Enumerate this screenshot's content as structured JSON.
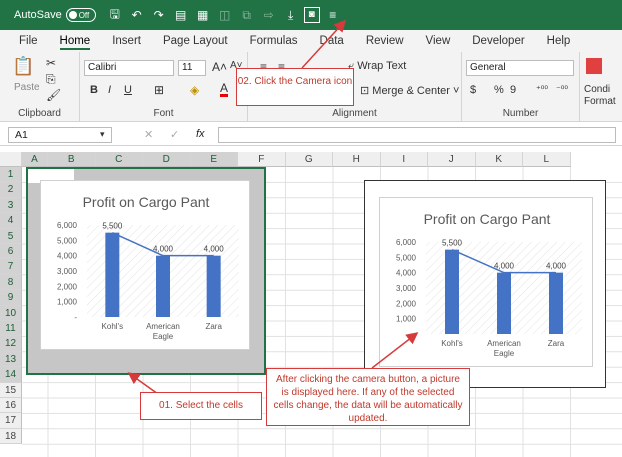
{
  "titlebar": {
    "autosave_label": "AutoSave",
    "autosave_state": "Off",
    "quick_access": [
      "save-icon",
      "undo-icon",
      "redo-icon",
      "format-painter-icon",
      "print-preview-icon",
      "camera-icon"
    ]
  },
  "tabs": [
    "File",
    "Home",
    "Insert",
    "Page Layout",
    "Formulas",
    "Data",
    "Review",
    "View",
    "Developer",
    "Help"
  ],
  "active_tab": "Home",
  "ribbon": {
    "clipboard_label": "Clipboard",
    "paste_label": "Paste",
    "font_label": "Font",
    "font_name": "Calibri",
    "font_size": "11",
    "bold": "B",
    "italic": "I",
    "underline": "U",
    "alignment_label": "Alignment",
    "wrap_text": "Wrap Text",
    "merge_center": "Merge & Center",
    "number_label": "Number",
    "number_format": "General",
    "currency": "$",
    "percent": "%",
    "comma": "9",
    "conditional": "Condi",
    "formatting": "Format"
  },
  "formula_bar": {
    "name_box": "A1",
    "fx": "fx",
    "value": ""
  },
  "columns": [
    "A",
    "B",
    "C",
    "D",
    "E",
    "F",
    "G",
    "H",
    "I",
    "J",
    "K",
    "L"
  ],
  "rows": [
    "1",
    "2",
    "3",
    "4",
    "5",
    "6",
    "7",
    "8",
    "9",
    "10",
    "11",
    "12",
    "13",
    "14",
    "15",
    "16",
    "17",
    "18"
  ],
  "callouts": {
    "camera": "02. Click the Camera icon",
    "select": "01. Select the cells",
    "info": "After clicking the camera button, a picture is displayed here. If any of the selected cells change, the data will be automatically updated."
  },
  "chart_data": [
    {
      "type": "bar",
      "title": "Profit on Cargo Pant",
      "categories": [
        "Kohl's",
        "American Eagle",
        "Zara"
      ],
      "values": [
        5500,
        4000,
        4000
      ],
      "value_labels": [
        "5,500",
        "4,000",
        "4,000"
      ],
      "trendline": true,
      "y_ticks": [
        "-",
        "1,000",
        "2,000",
        "3,000",
        "4,000",
        "5,000",
        "6,000"
      ],
      "ylim": [
        0,
        6000
      ],
      "bar_color": "#4472c4"
    },
    {
      "type": "bar",
      "title": "Profit on Cargo Pant",
      "categories": [
        "Kohl's",
        "American Eagle",
        "Zara"
      ],
      "values": [
        5500,
        4000,
        4000
      ],
      "value_labels": [
        "5,500",
        "4,000",
        "4,000"
      ],
      "trendline": true,
      "y_ticks": [
        "-",
        "1,000",
        "2,000",
        "3,000",
        "4,000",
        "5,000",
        "6,000"
      ],
      "ylim": [
        0,
        6000
      ],
      "bar_color": "#4472c4"
    }
  ],
  "colors": {
    "excel_green": "#217346",
    "callout_red": "#d63a3a"
  }
}
